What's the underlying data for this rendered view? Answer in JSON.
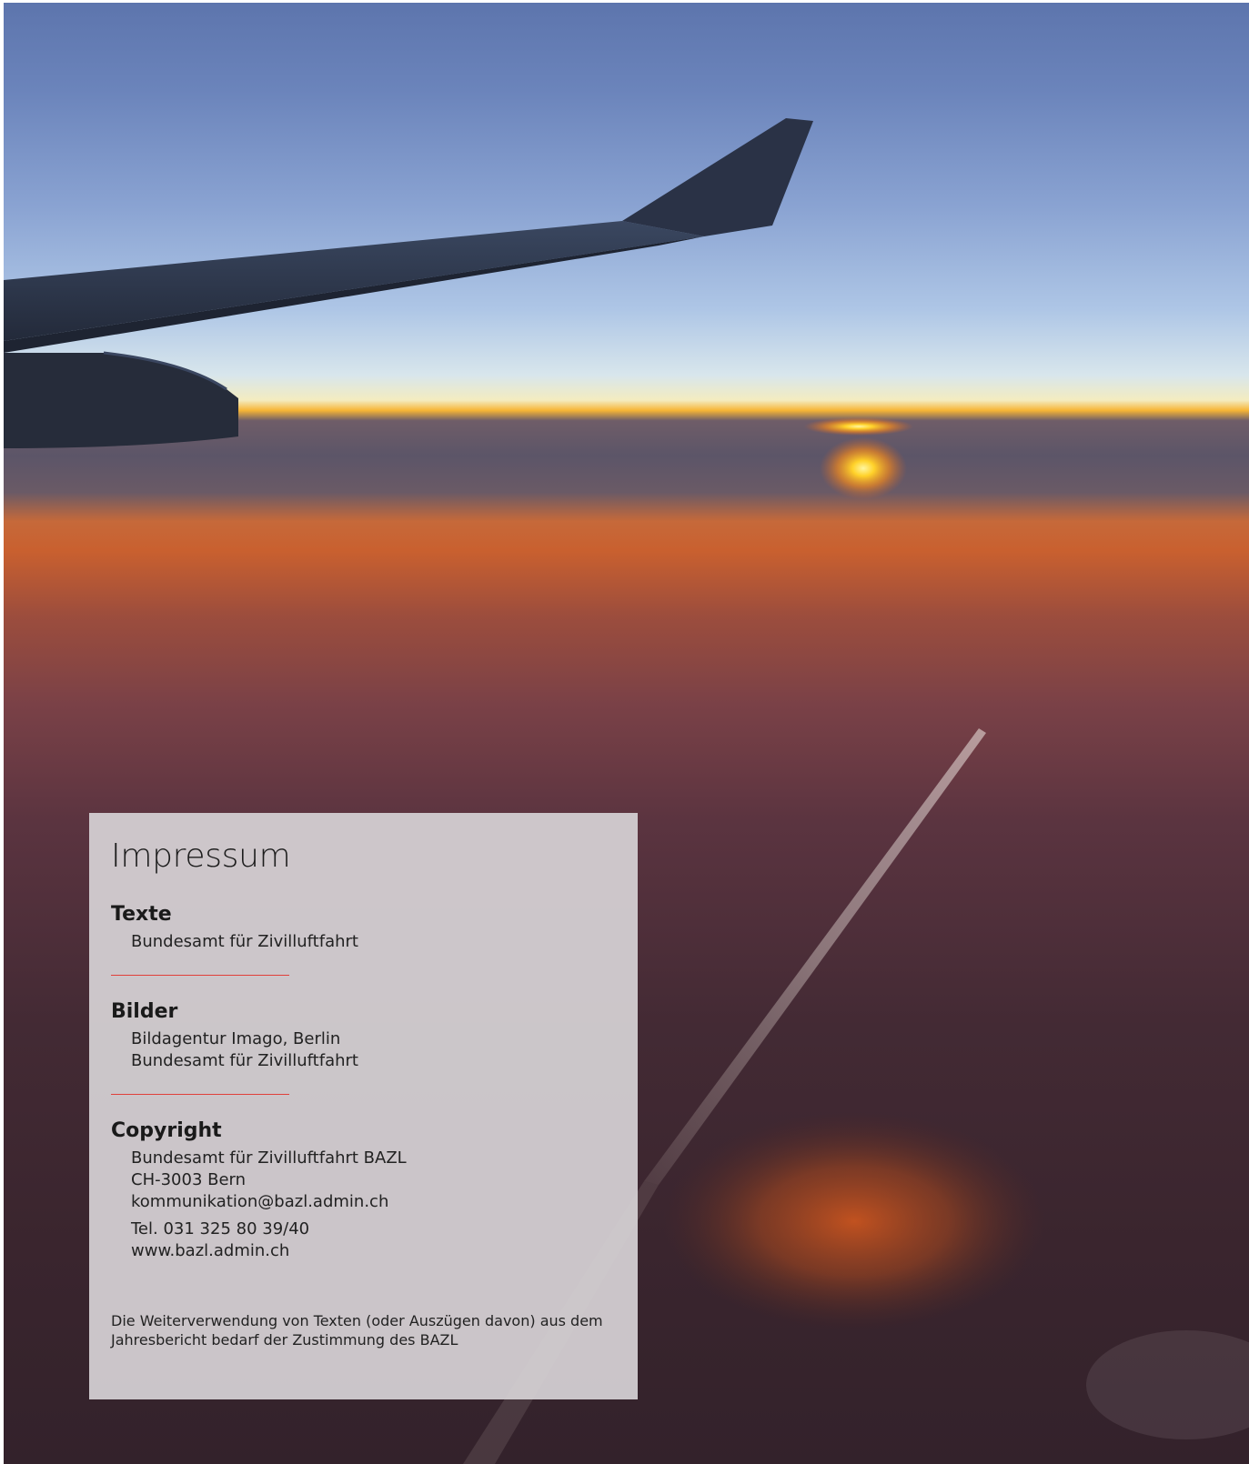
{
  "colors": {
    "divider": "#e0403a",
    "panel": "#d6d2d5",
    "text": "#1a1a1a"
  },
  "impressum": {
    "title": "Impressum",
    "texte": {
      "heading": "Texte",
      "lines": [
        "Bundesamt für Zivilluftfahrt"
      ]
    },
    "bilder": {
      "heading": "Bilder",
      "lines": [
        "Bildagentur Imago, Berlin",
        "Bundesamt für Zivilluftfahrt"
      ]
    },
    "copyright": {
      "heading": "Copyright",
      "lines": [
        "Bundesamt für Zivilluftfahrt BAZL",
        "CH-3003 Bern",
        "kommunikation@bazl.admin.ch",
        "Tel. 031 325 80 39/40",
        "www.bazl.admin.ch"
      ]
    },
    "notice": "Die Weiterverwendung von Texten (oder Auszügen davon) aus dem Jahresbericht bedarf der Zustimmung des BAZL"
  }
}
